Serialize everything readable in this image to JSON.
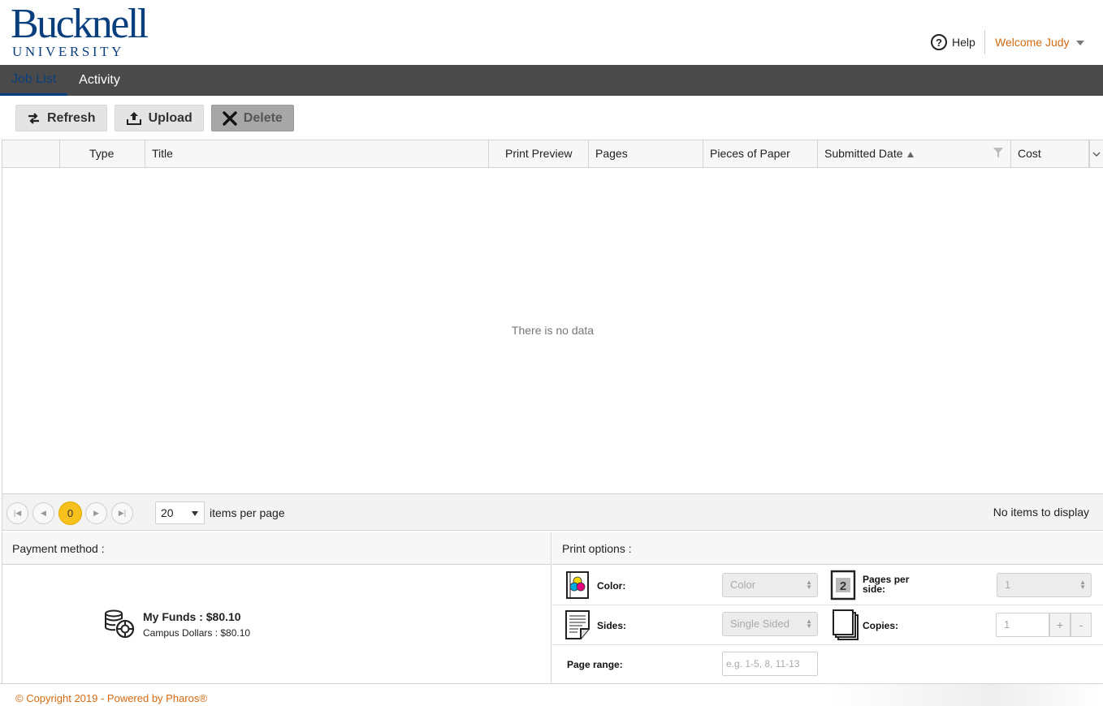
{
  "header": {
    "logo_main": "Bucknell",
    "logo_sub": "UNIVERSITY",
    "help_label": "Help",
    "welcome_label": "Welcome Judy"
  },
  "nav": {
    "tabs": [
      {
        "label": "Job List",
        "active": true
      },
      {
        "label": "Activity",
        "active": false
      }
    ]
  },
  "toolbar": {
    "refresh_label": "Refresh",
    "upload_label": "Upload",
    "delete_label": "Delete"
  },
  "grid": {
    "columns": [
      "",
      "Type",
      "Title",
      "Print Preview",
      "Pages",
      "Pieces of Paper",
      "Submitted Date",
      "Cost"
    ],
    "empty_text": "There is no data",
    "pager": {
      "current_page": "0",
      "page_size": "20",
      "page_size_label": "items per page",
      "info": "No items to display"
    }
  },
  "payment": {
    "title": "Payment method :",
    "funds_label": "My Funds : $80.10",
    "campus_label": "Campus Dollars : $80.10"
  },
  "print_options": {
    "title": "Print options :",
    "color_label": "Color:",
    "color_value": "Color",
    "pages_per_side_label": "Pages per side:",
    "pages_per_side_value": "1",
    "pages_per_side_icon_text": "2",
    "sides_label": "Sides:",
    "sides_value": "Single Sided",
    "copies_label": "Copies:",
    "copies_value": "1",
    "copies_plus": "+",
    "copies_minus": "-",
    "page_range_label": "Page range:",
    "page_range_placeholder": "e.g. 1-5, 8, 11-13"
  },
  "footer": {
    "copyright": "© Copyright 2019 - Powered by Pharos®"
  },
  "colors": {
    "brand_blue": "#0a3f7e",
    "accent_orange": "#d36a10",
    "nav_bg": "#4a4a4a",
    "pager_current": "#f7c11c"
  },
  "icons": [
    "help-icon",
    "caret-down-icon",
    "refresh-icon",
    "upload-icon",
    "delete-icon",
    "sort-asc-icon",
    "filter-icon",
    "column-menu-icon",
    "first-page-icon",
    "prev-page-icon",
    "next-page-icon",
    "last-page-icon",
    "coins-icon",
    "color-icon",
    "pages-per-side-icon",
    "sides-icon",
    "copies-icon"
  ]
}
